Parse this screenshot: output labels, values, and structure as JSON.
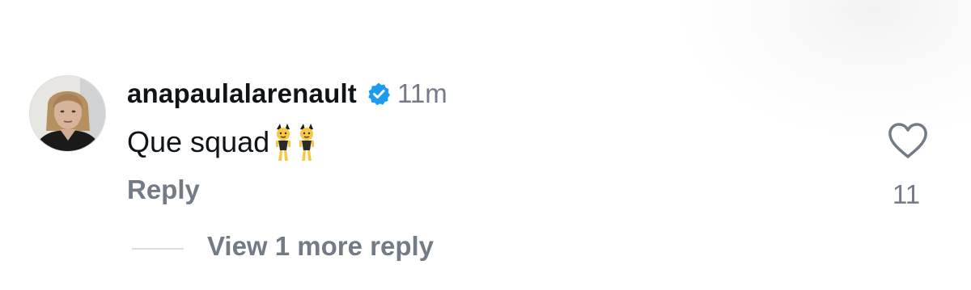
{
  "comment": {
    "username": "anapaulalarenault",
    "time": "11m",
    "text": "Que squad",
    "emoji": "👯‍♀️👯‍♀️",
    "reply_label": "Reply",
    "like_count": "11",
    "view_replies_label": "View 1 more reply"
  },
  "colors": {
    "username": "#0f1419",
    "secondary_text": "#737b86",
    "verified_blue": "#1d9bf0",
    "divider": "#dadde1"
  },
  "icons": {
    "verified": "verified-badge-icon",
    "like": "heart-outline-icon"
  }
}
